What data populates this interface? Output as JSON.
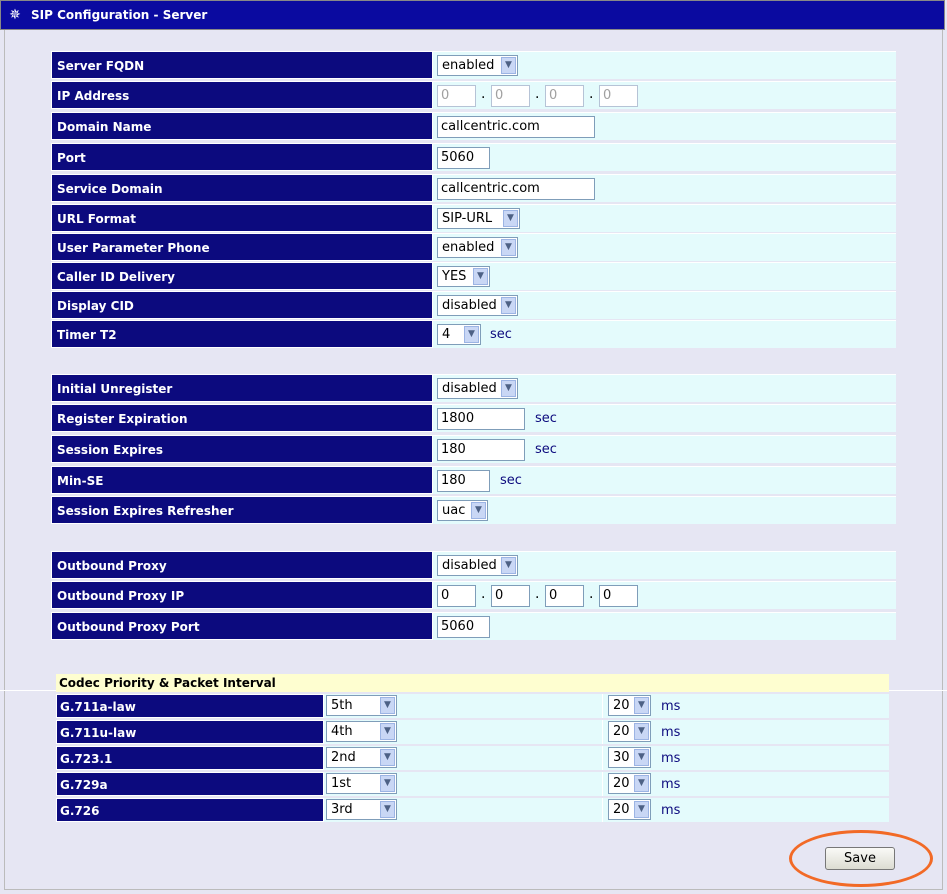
{
  "window": {
    "title": "SIP Configuration - Server"
  },
  "server": {
    "server_fqdn": {
      "label": "Server FQDN",
      "value": "enabled"
    },
    "ip_address": {
      "label": "IP Address",
      "octets": [
        "0",
        "0",
        "0",
        "0"
      ]
    },
    "domain_name": {
      "label": "Domain Name",
      "value": "callcentric.com"
    },
    "port": {
      "label": "Port",
      "value": "5060"
    },
    "service_domain": {
      "label": "Service Domain",
      "value": "callcentric.com"
    },
    "url_format": {
      "label": "URL Format",
      "value": "SIP-URL"
    },
    "user_param_phone": {
      "label": "User Parameter Phone",
      "value": "enabled"
    },
    "caller_id_delivery": {
      "label": "Caller ID Delivery",
      "value": "YES"
    },
    "display_cid": {
      "label": "Display CID",
      "value": "disabled"
    },
    "timer_t2": {
      "label": "Timer T2",
      "value": "4",
      "unit": "sec"
    }
  },
  "registration": {
    "initial_unregister": {
      "label": "Initial Unregister",
      "value": "disabled"
    },
    "register_expiration": {
      "label": "Register Expiration",
      "value": "1800",
      "unit": "sec"
    },
    "session_expires": {
      "label": "Session Expires",
      "value": "180",
      "unit": "sec"
    },
    "min_se": {
      "label": "Min-SE",
      "value": "180",
      "unit": "sec"
    },
    "session_expires_refresher": {
      "label": "Session Expires Refresher",
      "value": "uac"
    }
  },
  "proxy": {
    "outbound_proxy": {
      "label": "Outbound Proxy",
      "value": "disabled"
    },
    "outbound_proxy_ip": {
      "label": "Outbound Proxy IP",
      "octets": [
        "0",
        "0",
        "0",
        "0"
      ]
    },
    "outbound_proxy_port": {
      "label": "Outbound Proxy Port",
      "value": "5060"
    }
  },
  "codecs": {
    "title": "Codec Priority & Packet Interval",
    "unit": "ms",
    "rows": [
      {
        "name": "G.711a-law",
        "priority": "5th",
        "interval": "20"
      },
      {
        "name": "G.711u-law",
        "priority": "4th",
        "interval": "20"
      },
      {
        "name": "G.723.1",
        "priority": "2nd",
        "interval": "30"
      },
      {
        "name": "G.729a",
        "priority": "1st",
        "interval": "20"
      },
      {
        "name": "G.726",
        "priority": "3rd",
        "interval": "20"
      }
    ]
  },
  "actions": {
    "save_label": "Save"
  },
  "colors": {
    "label_bg": "#0c0a7e",
    "value_bg": "#e4fbfc",
    "highlight": "#f26a26",
    "title_bar": "#0a0aa0"
  },
  "icons": {
    "window_icon": "network-icon",
    "dropdown": "chevron-down-icon"
  }
}
